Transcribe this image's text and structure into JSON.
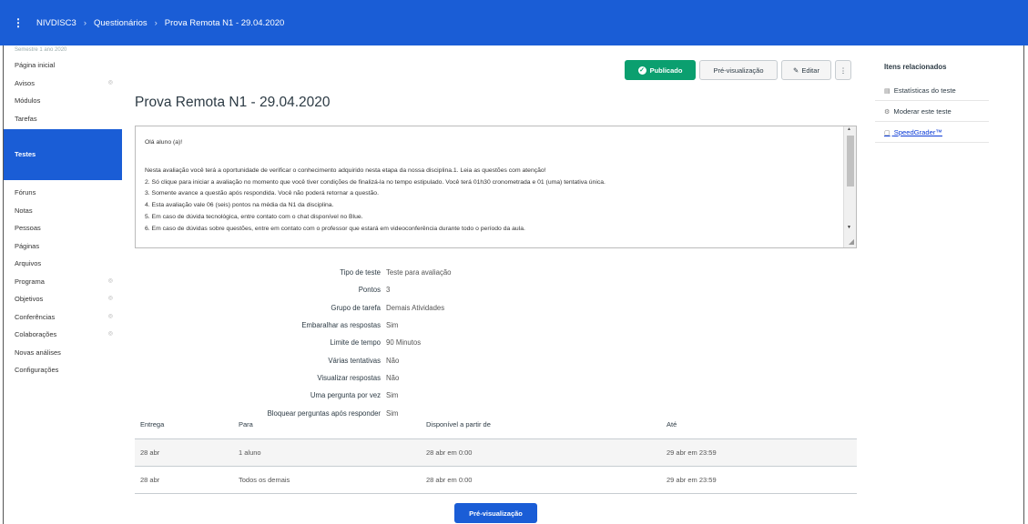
{
  "breadcrumb": {
    "menu_icon": "hamburger-icon",
    "items": [
      "NIVDISC3",
      "Questionários",
      "Prova Remota N1 - 29.04.2020"
    ],
    "separator": "›"
  },
  "sidebar": {
    "term": "Semestre 1 ano 2020",
    "items": [
      {
        "label": "Página inicial",
        "hidden": false
      },
      {
        "label": "Avisos",
        "hidden": true
      },
      {
        "label": "Módulos",
        "hidden": false
      },
      {
        "label": "Tarefas",
        "hidden": false
      },
      {
        "label": "Testes",
        "hidden": false,
        "active": true
      },
      {
        "label": "Fóruns",
        "hidden": false
      },
      {
        "label": "Notas",
        "hidden": false
      },
      {
        "label": "Pessoas",
        "hidden": false
      },
      {
        "label": "Páginas",
        "hidden": false
      },
      {
        "label": "Arquivos",
        "hidden": false
      },
      {
        "label": "Programa",
        "hidden": true
      },
      {
        "label": "Objetivos",
        "hidden": true
      },
      {
        "label": "Conferências",
        "hidden": true
      },
      {
        "label": "Colaborações",
        "hidden": true
      },
      {
        "label": "Novas análises",
        "hidden": false
      },
      {
        "label": "Configurações",
        "hidden": false
      }
    ]
  },
  "toolbar": {
    "published_label": "Publicado",
    "preview_label": "Pré-visualização",
    "edit_label": "Editar",
    "more_label": "⋮"
  },
  "quiz": {
    "title": "Prova Remota N1 - 29.04.2020",
    "description": {
      "greeting": "Olá aluno (a)!",
      "lines": [
        "Nesta avaliação você terá a oportunidade de verificar o conhecimento adquirido nesta etapa da nossa disciplina.1. Leia as questões com atenção!",
        "2. Só clique para iniciar a avaliação no momento que você tiver condições de finalizá-la no tempo estipulado. Você terá 01h30 cronometrada e 01 (uma) tentativa única.",
        "3. Somente avance a questão após respondida. Você não poderá retornar a questão.",
        "4. Esta avaliação vale 06 (seis) pontos na média da N1 da disciplina.",
        "5. Em caso de dúvida tecnológica, entre contato com o chat disponível no Blue.",
        "6. Em caso de dúvidas sobre questões, entre em contato com o professor que estará em videoconferência durante todo o período da aula."
      ]
    },
    "details": [
      {
        "label": "Tipo de teste",
        "value": "Teste para avaliação"
      },
      {
        "label": "Pontos",
        "value": "3"
      },
      {
        "label": "Grupo de tarefa",
        "value": "Demais Atividades"
      },
      {
        "label": "Embaralhar as respostas",
        "value": "Sim"
      },
      {
        "label": "Limite de tempo",
        "value": "90 Minutos"
      },
      {
        "label": "Várias tentativas",
        "value": "Não"
      },
      {
        "label": "Visualizar respostas",
        "value": "Não"
      },
      {
        "label": "Uma pergunta por vez",
        "value": "Sim"
      },
      {
        "label": "Bloquear perguntas após responder",
        "value": "Sim"
      }
    ],
    "table": {
      "headers": [
        "Entrega",
        "Para",
        "Disponível a partir de",
        "Até"
      ],
      "rows": [
        [
          "28 abr",
          "1 aluno",
          "28 abr em 0:00",
          "29 abr em 23:59"
        ],
        [
          "28 abr",
          "Todos os demais",
          "28 abr em 0:00",
          "29 abr em 23:59"
        ]
      ]
    },
    "preview_button": "Pré-visualização"
  },
  "related": {
    "heading": "Itens relacionados",
    "items": [
      {
        "label": "Estatísticas do teste",
        "icon": "stats-icon"
      },
      {
        "label": "Moderar este teste",
        "icon": "gear-icon"
      },
      {
        "label": "SpeedGrader™",
        "icon": "speedgrader-icon",
        "highlighted": true
      }
    ]
  },
  "colors": {
    "brand": "#1a5dd6",
    "published": "#0b9f6f",
    "highlight": "#e4131a"
  }
}
